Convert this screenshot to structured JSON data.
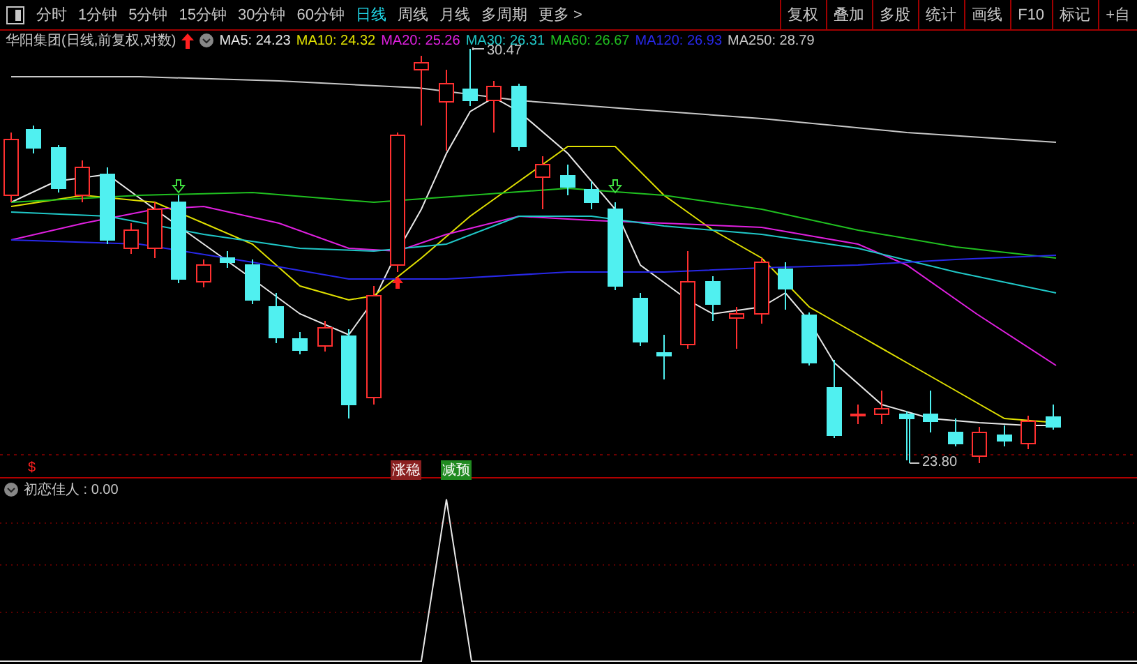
{
  "toolbar": {
    "tabs": [
      {
        "label": "分时",
        "selected": false
      },
      {
        "label": "1分钟",
        "selected": false
      },
      {
        "label": "5分钟",
        "selected": false
      },
      {
        "label": "15分钟",
        "selected": false
      },
      {
        "label": "30分钟",
        "selected": false
      },
      {
        "label": "60分钟",
        "selected": false
      },
      {
        "label": "日线",
        "selected": true
      },
      {
        "label": "周线",
        "selected": false
      },
      {
        "label": "月线",
        "selected": false
      },
      {
        "label": "多周期",
        "selected": false
      },
      {
        "label": "更多 >",
        "selected": false
      }
    ],
    "buttons": [
      "复权",
      "叠加",
      "多股",
      "统计",
      "画线",
      "F10",
      "标记",
      "+自"
    ]
  },
  "chart": {
    "title": "华阳集团(日线,前复权,对数)",
    "moving_averages": [
      {
        "label": "MA5: 24.23",
        "color": "#e8e8e8"
      },
      {
        "label": "MA10: 24.32",
        "color": "#e0e000"
      },
      {
        "label": "MA20: 25.26",
        "color": "#e020e0"
      },
      {
        "label": "MA30: 26.31",
        "color": "#20c8c8"
      },
      {
        "label": "MA60: 26.67",
        "color": "#20c020"
      },
      {
        "label": "MA120: 26.93",
        "color": "#2828e8"
      },
      {
        "label": "MA250: 28.79",
        "color": "#c8c8c8"
      }
    ],
    "high_label": "30.47",
    "low_label": "23.80",
    "marker": "$",
    "signal_tags": [
      {
        "label": "涨稳",
        "color": "#8a2020"
      },
      {
        "label": "减预",
        "color": "#208a20"
      }
    ]
  },
  "indicator": {
    "label": "初恋佳人 : 0.00"
  }
}
